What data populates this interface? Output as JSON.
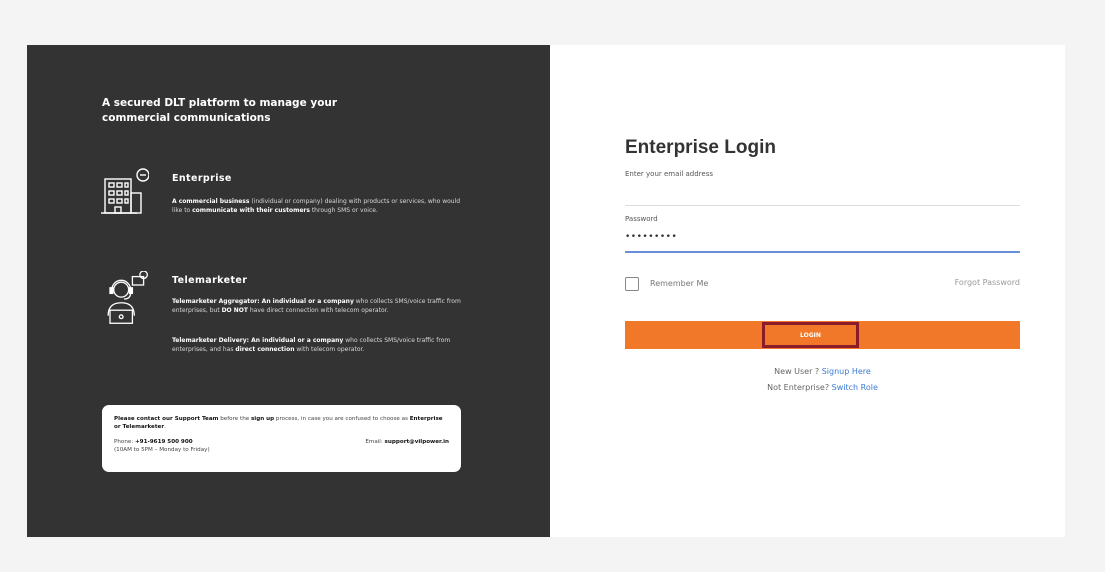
{
  "left_panel": {
    "tagline": "A secured DLT platform to manage your commercial communications",
    "enterprise": {
      "title": "Enterprise",
      "desc_bold_1": "A commercial business",
      "desc_1": " (individual or company) dealing with products or services, who would like to ",
      "desc_bold_2": "communicate with their customers",
      "desc_2": " through SMS or voice."
    },
    "telemarketer": {
      "title": "Telemarketer",
      "agg_bold": "Telemarketer Aggregator: An individual or a company",
      "agg_text_1": " who collects SMS/voice traffic from enterprises, but ",
      "agg_bold_2": "DO NOT",
      "agg_text_2": " have direct connection with telecom operator.",
      "del_bold": "Telemarketer Delivery: An individual or a company",
      "del_text_1": " who collects SMS/voice traffic from enterprises, and has ",
      "del_bold_2": "direct connection",
      "del_text_2": " with  telecom operator."
    },
    "support": {
      "intro_1": "Please contact our ",
      "intro_bold_1": "Support Team",
      "intro_2": " before the ",
      "intro_bold_2": "sign up",
      "intro_3": " process, in case you are confused to choose as ",
      "intro_bold_3": "Enterprise or Telemarketer",
      "intro_4": ".",
      "phone_label": "Phone: ",
      "phone": "+91-9619 500 900",
      "hours": "(10AM to 5PM – Monday to Friday)",
      "email_label": "Email: ",
      "email": "support@vilpower.in"
    }
  },
  "login": {
    "title": "Enterprise Login",
    "email_placeholder": "Enter your email address",
    "password_label": "Password",
    "password_value": "•••••••••",
    "remember_label": "Remember Me",
    "forgot_label": "Forgot Password",
    "login_label": "LOGIN",
    "new_user_text": "New User ?",
    "signup_link": "Signup Here",
    "not_enterprise_text": "Not Enterprise?",
    "switch_link": "Switch Role"
  },
  "colors": {
    "left_bg": "#333333",
    "accent_orange": "#f07828",
    "link_blue": "#3a7bd5",
    "highlight_border": "#8a1c2a"
  },
  "icons": {
    "enterprise": "building-chat-icon",
    "telemarketer": "headset-agent-icon"
  }
}
